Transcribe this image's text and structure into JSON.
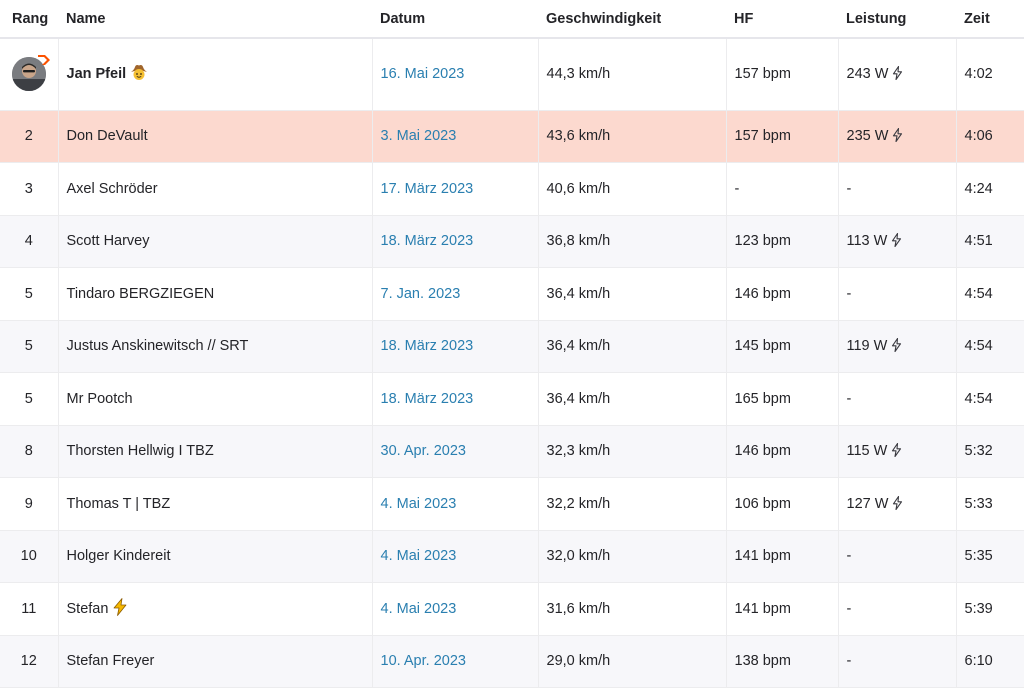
{
  "columns": {
    "rank": "Rang",
    "name": "Name",
    "date": "Datum",
    "speed": "Geschwindigkeit",
    "hr": "HF",
    "power": "Leistung",
    "time": "Zeit"
  },
  "colors": {
    "highlight_row": "#fcd9cf",
    "link": "#2a7fb0",
    "crown": "#fc5200"
  },
  "rows": [
    {
      "rank": "",
      "name": "Jan Pfeil",
      "name_icon": "cowboy-emoji",
      "date": "16. Mai 2023",
      "speed": "44,3 km/h",
      "hr": "157 bpm",
      "power": "243 W",
      "power_icon": "bolt-icon",
      "time": "4:02"
    },
    {
      "rank": "2",
      "name": "Don DeVault",
      "date": "3. Mai 2023",
      "speed": "43,6 km/h",
      "hr": "157 bpm",
      "power": "235 W",
      "power_icon": "bolt-icon",
      "time": "4:06"
    },
    {
      "rank": "3",
      "name": "Axel Schröder",
      "date": "17. März 2023",
      "speed": "40,6 km/h",
      "hr": "-",
      "power": "-",
      "time": "4:24"
    },
    {
      "rank": "4",
      "name": "Scott Harvey",
      "date": "18. März 2023",
      "speed": "36,8 km/h",
      "hr": "123 bpm",
      "power": "113 W",
      "power_icon": "bolt-icon",
      "time": "4:51"
    },
    {
      "rank": "5",
      "name": "Tindaro BERGZIEGEN",
      "date": "7. Jan. 2023",
      "speed": "36,4 km/h",
      "hr": "146 bpm",
      "power": "-",
      "time": "4:54"
    },
    {
      "rank": "5",
      "name": "Justus Anskinewitsch // SRT",
      "date": "18. März 2023",
      "speed": "36,4 km/h",
      "hr": "145 bpm",
      "power": "119 W",
      "power_icon": "bolt-icon",
      "time": "4:54"
    },
    {
      "rank": "5",
      "name": "Mr Pootch",
      "date": "18. März 2023",
      "speed": "36,4 km/h",
      "hr": "165 bpm",
      "power": "-",
      "time": "4:54"
    },
    {
      "rank": "8",
      "name": "Thorsten Hellwig I TBZ",
      "date": "30. Apr. 2023",
      "speed": "32,3 km/h",
      "hr": "146 bpm",
      "power": "115 W",
      "power_icon": "bolt-icon",
      "time": "5:32"
    },
    {
      "rank": "9",
      "name": "Thomas T | TBZ",
      "date": "4. Mai 2023",
      "speed": "32,2 km/h",
      "hr": "106 bpm",
      "power": "127 W",
      "power_icon": "bolt-icon",
      "time": "5:33"
    },
    {
      "rank": "10",
      "name": "Holger Kindereit",
      "date": "4. Mai 2023",
      "speed": "32,0 km/h",
      "hr": "141 bpm",
      "power": "-",
      "time": "5:35"
    },
    {
      "rank": "11",
      "name": "Stefan",
      "name_icon": "lightning-emoji",
      "date": "4. Mai 2023",
      "speed": "31,6 km/h",
      "hr": "141 bpm",
      "power": "-",
      "time": "5:39"
    },
    {
      "rank": "12",
      "name": "Stefan Freyer",
      "date": "10. Apr. 2023",
      "speed": "29,0 km/h",
      "hr": "138 bpm",
      "power": "-",
      "time": "6:10"
    }
  ]
}
